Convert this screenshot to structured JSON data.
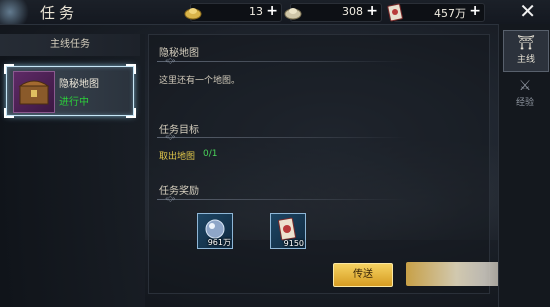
{
  "window": {
    "title": "任务"
  },
  "resources": [
    {
      "icon": "gold-ingot-icon",
      "value": "13",
      "add": "+"
    },
    {
      "icon": "silver-ingot-icon",
      "value": "308",
      "add": "+"
    },
    {
      "icon": "card-icon",
      "value": "457万",
      "add": "+"
    }
  ],
  "close_label": "✕",
  "sidebar": {
    "header": "主线任务",
    "quest": {
      "name": "隐秘地图",
      "status": "进行中"
    }
  },
  "detail": {
    "name_title": "隐秘地图",
    "description": "这里还有一个地图。",
    "objective_title": "任务目标",
    "objective_label": "取出地图",
    "objective_progress": "0/1",
    "reward_title": "任务奖励",
    "rewards": [
      {
        "icon": "exp-orb-icon",
        "amount": "961万"
      },
      {
        "icon": "card-reward-icon",
        "amount": "9150"
      }
    ],
    "teleport_label": "传送"
  },
  "tabs": [
    {
      "icon": "main-quest-icon",
      "glyph": "⛩",
      "label": "主线",
      "active": true
    },
    {
      "icon": "experience-icon",
      "glyph": "⚔",
      "label": "经验",
      "active": false
    }
  ]
}
